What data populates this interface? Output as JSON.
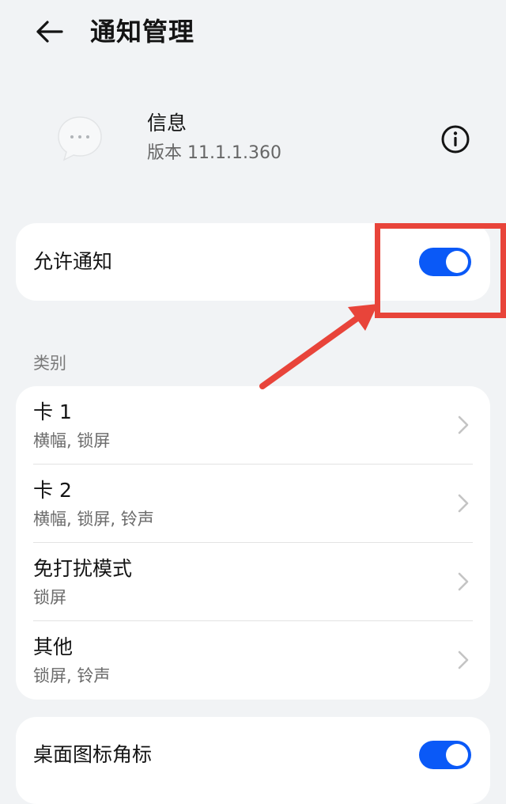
{
  "header": {
    "title": "通知管理",
    "back_icon": "back-arrow-icon"
  },
  "app": {
    "name": "信息",
    "version": "版本 11.1.1.360",
    "icon": "message-bubble-icon",
    "info_icon": "info-icon"
  },
  "allow_notifications": {
    "label": "允许通知",
    "enabled": true
  },
  "category": {
    "section_label": "类别",
    "items": [
      {
        "title": "卡 1",
        "subtitle": "横幅, 锁屏"
      },
      {
        "title": "卡 2",
        "subtitle": "横幅, 锁屏, 铃声"
      },
      {
        "title": "免打扰模式",
        "subtitle": "锁屏"
      },
      {
        "title": "其他",
        "subtitle": "锁屏, 铃声"
      }
    ]
  },
  "badge": {
    "label": "桌面图标角标",
    "enabled": true
  },
  "colors": {
    "accent": "#0a59f7",
    "background": "#f1f3f5",
    "annotation": "#e8443a"
  }
}
